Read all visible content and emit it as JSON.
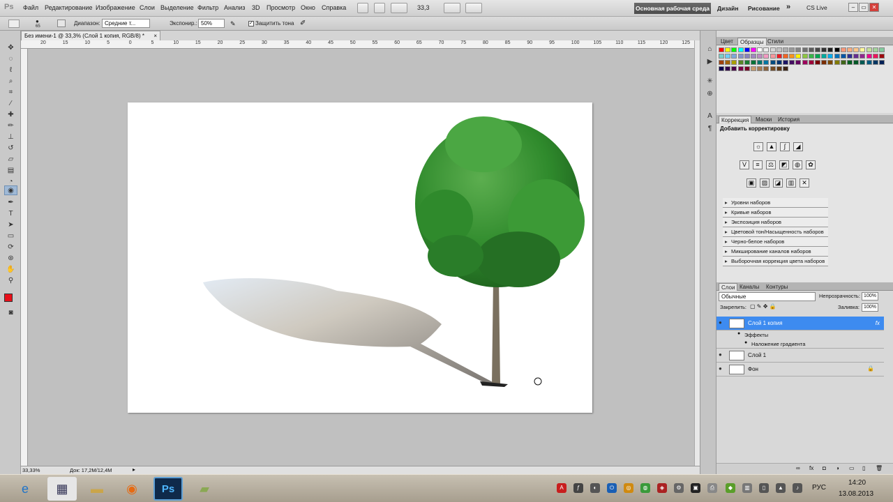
{
  "app": {
    "logo": "Ps",
    "menu": [
      "Файл",
      "Редактирование",
      "Изображение",
      "Слои",
      "Выделение",
      "Фильтр",
      "Анализ",
      "3D",
      "Просмотр",
      "Окно",
      "Справка"
    ],
    "zoom_field": "33,3",
    "workspaces": {
      "active": "Основная рабочая среда",
      "design": "Дизайн",
      "drawing": "Рисование",
      "more": "»"
    },
    "cs_live": "CS Live"
  },
  "options": {
    "brush_size": "65",
    "range_label": "Диапазон:",
    "range_value": "Средние т...",
    "exposure_label": "Экспонир.:",
    "exposure_value": "50%",
    "protect_tones": "Защитить тона"
  },
  "document": {
    "tab_title": "Без имени-1 @ 33,3% (Слой 1 копия, RGB/8) *",
    "ruler_numbers": [
      "20",
      "15",
      "10",
      "5",
      "0",
      "5",
      "10",
      "15",
      "20",
      "25",
      "30",
      "35",
      "40",
      "45",
      "50",
      "55",
      "60",
      "65",
      "70",
      "75",
      "80",
      "85",
      "90",
      "95",
      "100",
      "105",
      "110",
      "115",
      "120",
      "125"
    ],
    "zoom": "33,33%",
    "doc_size": "Док: 17,2M/12,4M"
  },
  "swatches_panel": {
    "tabs": [
      "Цвет",
      "Образцы",
      "Стили"
    ],
    "active_tab": "Образцы"
  },
  "adjust_panel": {
    "tabs": [
      "Коррекция",
      "Маски",
      "История"
    ],
    "active_tab": "Коррекция",
    "title": "Добавить корректировку",
    "presets": [
      "Уровни наборов",
      "Кривые наборов",
      "Экспозиция наборов",
      "Цветовой тон/Насыщенность наборов",
      "Черно-белое наборов",
      "Микширование каналов наборов",
      "Выборочная коррекция цвета наборов"
    ]
  },
  "layers_panel": {
    "tabs": [
      "Слои",
      "Каналы",
      "Контуры"
    ],
    "active_tab": "Слои",
    "blend_mode": "Обычные",
    "opacity_label": "Непрозрачность:",
    "opacity_value": "100%",
    "lock_label": "Закрепить:",
    "fill_label": "Заливка:",
    "fill_value": "100%",
    "layers": [
      {
        "name": "Слой 1 копия",
        "fx": "fx"
      },
      {
        "name": "Эффекты"
      },
      {
        "name": "Наложение градиента"
      },
      {
        "name": "Слой 1"
      },
      {
        "name": "Фон"
      }
    ]
  },
  "taskbar": {
    "language": "РУС",
    "time": "14:20",
    "date": "13.08.2013",
    "ps_label": "Ps"
  },
  "colors": {
    "foreground": "#e8101a",
    "selection": "#3d8bf0",
    "tree_green": "#2f8a2c"
  }
}
